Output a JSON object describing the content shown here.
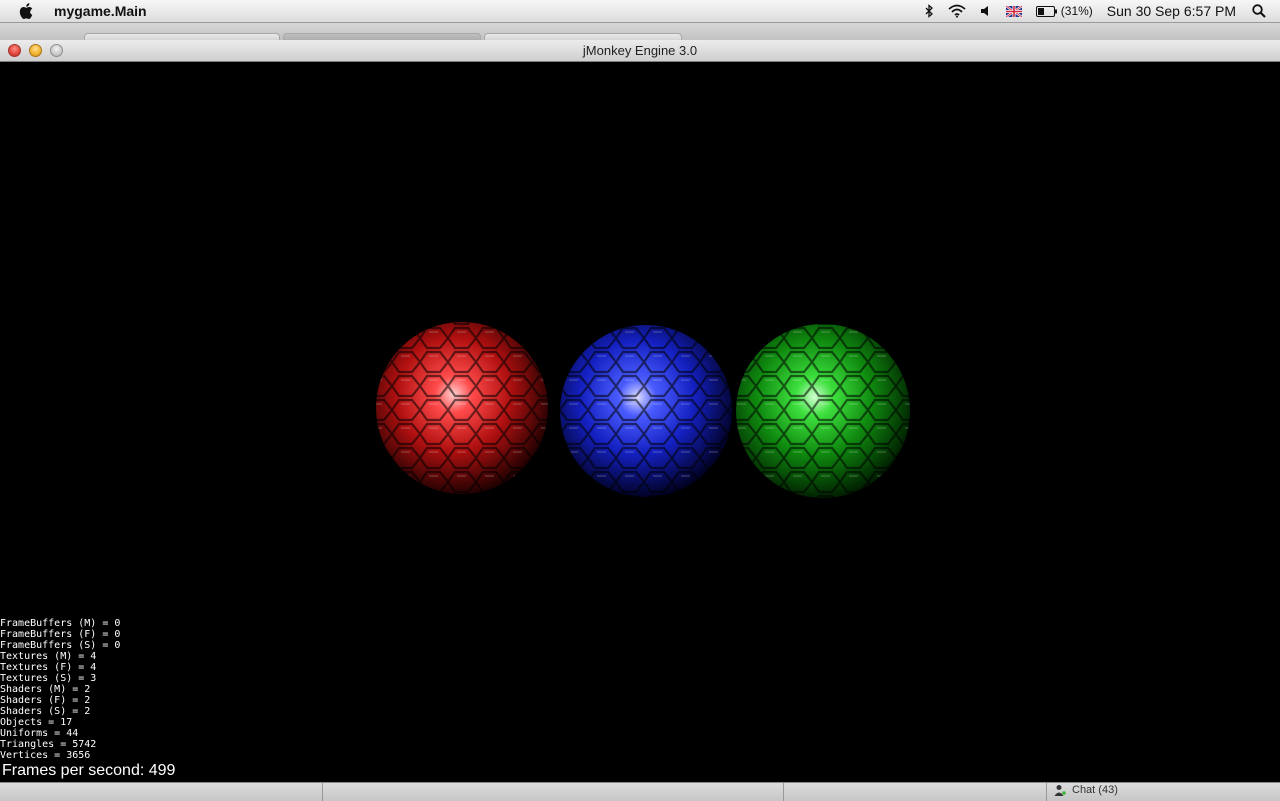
{
  "menubar": {
    "app_name": "mygame.Main",
    "battery": "(31%)",
    "datetime": "Sun 30 Sep  6:57 PM"
  },
  "window": {
    "title": "jMonkey Engine 3.0"
  },
  "scene": {
    "spheres": [
      {
        "name": "red-sphere",
        "color": "#e02020"
      },
      {
        "name": "blue-sphere",
        "color": "#2a3cff"
      },
      {
        "name": "green-sphere",
        "color": "#22c020"
      }
    ]
  },
  "stats": [
    "FrameBuffers (M) = 0",
    "FrameBuffers (F) = 0",
    "FrameBuffers (S) = 0",
    "Textures (M) = 4",
    "Textures (F) = 4",
    "Textures (S) = 3",
    "Shaders (M) = 2",
    "Shaders (F) = 2",
    "Shaders (S) = 2",
    "Objects = 17",
    "Uniforms = 44",
    "Triangles = 5742",
    "Vertices = 3656"
  ],
  "fps_label": "Frames per second: 499",
  "dock": {
    "chat_label": "Chat (43)"
  }
}
